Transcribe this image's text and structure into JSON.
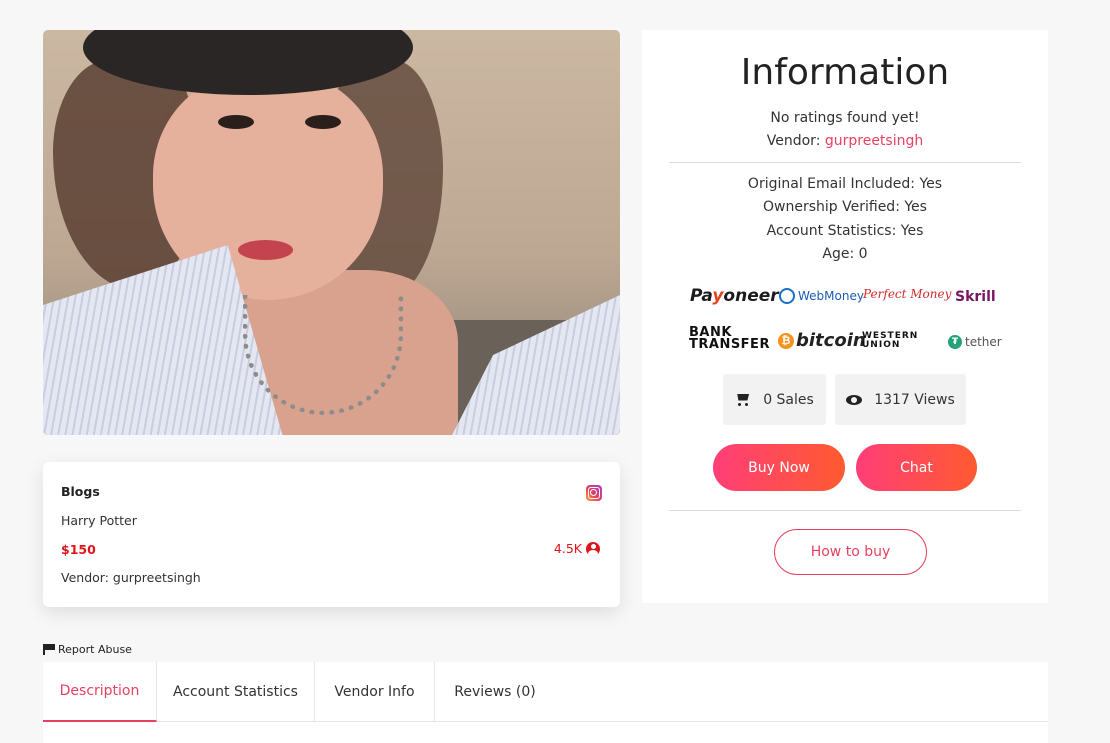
{
  "card": {
    "category": "Blogs",
    "title": "Harry Potter",
    "price": "$150",
    "vendor": "Vendor: gurpreetsingh",
    "followers": "4.5K",
    "platform_icon": "instagram-icon",
    "price_color": "#e0141b"
  },
  "info": {
    "heading": "Information",
    "ratings": "No ratings found yet!",
    "vendor_label": "Vendor: ",
    "vendor_name": "gurpreetsingh",
    "details": [
      "Original Email Included: Yes",
      "Ownership Verified: Yes",
      "Account Statistics: Yes",
      "Age: 0"
    ],
    "payment_methods": {
      "payoneer_a": "Pa",
      "payoneer_y": "y",
      "payoneer_b": "oneer",
      "webmoney": "WebMoney",
      "perfect_money": "Perfect Money",
      "skrill": "Skrill",
      "bank_1": "BANK",
      "bank_2": "TRANSFER",
      "bitcoin": "bitcoin",
      "western_1": "WESTERN",
      "western_2": "UNION",
      "tether": "tether"
    },
    "sales": "0 Sales",
    "views": "1317 Views",
    "buy_label": "Buy Now",
    "chat_label": "Chat",
    "how_label": "How to buy",
    "accent": "#e8415f"
  },
  "report": "Report Abuse",
  "tabs": [
    "Description",
    "Account Statistics",
    "Vendor Info",
    "Reviews (0)"
  ]
}
